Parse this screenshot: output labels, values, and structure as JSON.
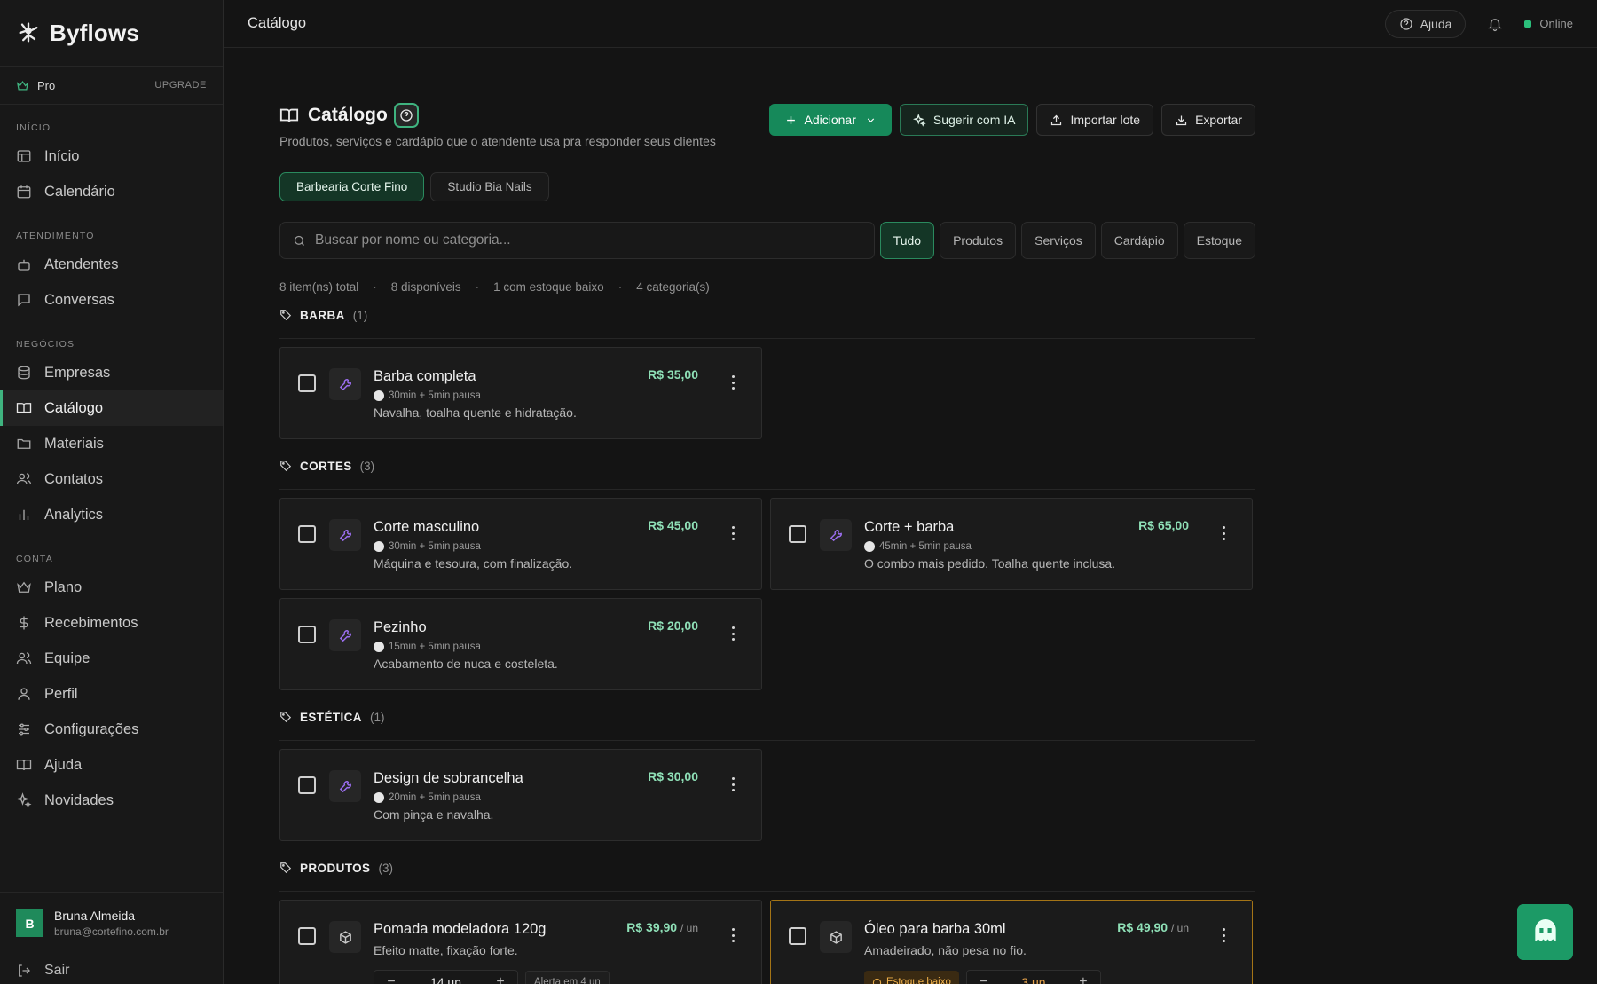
{
  "app": {
    "name": "Byflows"
  },
  "plan": {
    "name": "Pro",
    "upgrade": "UPGRADE"
  },
  "nav": {
    "sections": [
      {
        "title": "INÍCIO",
        "items": [
          {
            "label": "Início",
            "icon": "layout-icon"
          },
          {
            "label": "Calendário",
            "icon": "calendar-icon"
          }
        ]
      },
      {
        "title": "ATENDIMENTO",
        "items": [
          {
            "label": "Atendentes",
            "icon": "bot-icon"
          },
          {
            "label": "Conversas",
            "icon": "chat-icon"
          }
        ]
      },
      {
        "title": "NEGÓCIOS",
        "items": [
          {
            "label": "Empresas",
            "icon": "database-icon"
          },
          {
            "label": "Catálogo",
            "icon": "book-icon",
            "active": true
          },
          {
            "label": "Materiais",
            "icon": "folder-icon"
          },
          {
            "label": "Contatos",
            "icon": "users-icon"
          },
          {
            "label": "Analytics",
            "icon": "bar-chart-icon"
          }
        ]
      },
      {
        "title": "CONTA",
        "items": [
          {
            "label": "Plano",
            "icon": "crown-icon"
          },
          {
            "label": "Recebimentos",
            "icon": "dollar-icon"
          },
          {
            "label": "Equipe",
            "icon": "team-icon"
          },
          {
            "label": "Perfil",
            "icon": "user-icon"
          },
          {
            "label": "Configurações",
            "icon": "sliders-icon"
          },
          {
            "label": "Ajuda",
            "icon": "book-icon"
          },
          {
            "label": "Novidades",
            "icon": "sparkles-icon"
          }
        ]
      }
    ]
  },
  "user": {
    "initial": "B",
    "name": "Bruna Almeida",
    "email": "bruna@cortefino.com.br",
    "logout": "Sair"
  },
  "topbar": {
    "title": "Catálogo",
    "help": "Ajuda",
    "status": "Online"
  },
  "page": {
    "title": "Catálogo",
    "subtitle": "Produtos, serviços e cardápio que o atendente usa pra responder seus clientes",
    "actions": {
      "add": "Adicionar",
      "suggest": "Sugerir com IA",
      "import": "Importar lote",
      "export": "Exportar"
    },
    "businesses": [
      {
        "label": "Barbearia Corte Fino",
        "active": true
      },
      {
        "label": "Studio Bia Nails",
        "active": false
      }
    ],
    "search": {
      "placeholder": "Buscar por nome ou categoria...",
      "value": ""
    },
    "filters": [
      {
        "label": "Tudo",
        "active": true
      },
      {
        "label": "Produtos"
      },
      {
        "label": "Serviços"
      },
      {
        "label": "Cardápio"
      },
      {
        "label": "Estoque"
      }
    ],
    "stats": [
      "8 item(ns) total",
      "8 disponíveis",
      "1 com estoque baixo",
      "4 categoria(s)"
    ]
  },
  "categories": [
    {
      "name": "BARBA",
      "count": "(1)",
      "items": [
        {
          "name": "Barba completa",
          "meta": "30min + 5min pausa",
          "desc": "Navalha, toalha quente e hidratação.",
          "price": "R$ 35,00"
        }
      ]
    },
    {
      "name": "CORTES",
      "count": "(3)",
      "items": [
        {
          "name": "Corte masculino",
          "meta": "30min + 5min pausa",
          "desc": "Máquina e tesoura, com finalização.",
          "price": "R$ 45,00"
        },
        {
          "name": "Corte + barba",
          "meta": "45min + 5min pausa",
          "desc": "O combo mais pedido. Toalha quente inclusa.",
          "price": "R$ 65,00"
        },
        {
          "name": "Pezinho",
          "meta": "15min + 5min pausa",
          "desc": "Acabamento de nuca e costeleta.",
          "price": "R$ 20,00"
        }
      ]
    },
    {
      "name": "ESTÉTICA",
      "count": "(1)",
      "items": [
        {
          "name": "Design de sobrancelha",
          "meta": "20min + 5min pausa",
          "desc": "Com pinça e navalha.",
          "price": "R$ 30,00"
        }
      ]
    },
    {
      "name": "PRODUTOS",
      "count": "(3)",
      "items": [
        {
          "name": "Pomada modeladora 120g",
          "desc": "Efeito matte, fixação forte.",
          "price": "R$ 39,90",
          "unit": "/ un",
          "stock": "14 un",
          "alert": "Alerta em 4 un"
        },
        {
          "name": "Óleo para barba 30ml",
          "desc": "Amadeirado, não pesa no fio.",
          "price": "R$ 49,90",
          "unit": "/ un",
          "stock": "3 un",
          "badge": "Estoque baixo"
        }
      ]
    }
  ],
  "colors": {
    "accent": "#16895a",
    "price": "#8fe0b7",
    "warning": "#a47416",
    "service_icon": "#9d6ff2"
  }
}
